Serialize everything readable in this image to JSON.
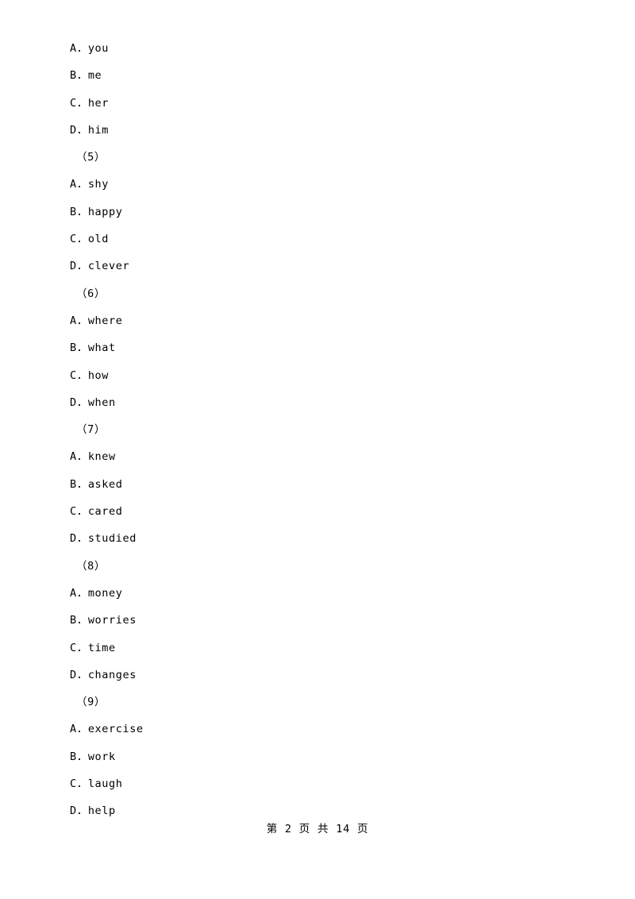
{
  "document": {
    "lines": [
      {
        "type": "option",
        "text": "A．you"
      },
      {
        "type": "option",
        "text": "B．me"
      },
      {
        "type": "option",
        "text": "C．her"
      },
      {
        "type": "option",
        "text": "D．him"
      },
      {
        "type": "group",
        "text": "（5）"
      },
      {
        "type": "option",
        "text": "A．shy"
      },
      {
        "type": "option",
        "text": "B．happy"
      },
      {
        "type": "option",
        "text": "C．old"
      },
      {
        "type": "option",
        "text": "D．clever"
      },
      {
        "type": "group",
        "text": "（6）"
      },
      {
        "type": "option",
        "text": "A．where"
      },
      {
        "type": "option",
        "text": "B．what"
      },
      {
        "type": "option",
        "text": "C．how"
      },
      {
        "type": "option",
        "text": "D．when"
      },
      {
        "type": "group",
        "text": "（7）"
      },
      {
        "type": "option",
        "text": "A．knew"
      },
      {
        "type": "option",
        "text": "B．asked"
      },
      {
        "type": "option",
        "text": "C．cared"
      },
      {
        "type": "option",
        "text": "D．studied"
      },
      {
        "type": "group",
        "text": "（8）"
      },
      {
        "type": "option",
        "text": "A．money"
      },
      {
        "type": "option",
        "text": "B．worries"
      },
      {
        "type": "option",
        "text": "C．time"
      },
      {
        "type": "option",
        "text": "D．changes"
      },
      {
        "type": "group",
        "text": "（9）"
      },
      {
        "type": "option",
        "text": "A．exercise"
      },
      {
        "type": "option",
        "text": "B．work"
      },
      {
        "type": "option",
        "text": "C．laugh"
      },
      {
        "type": "option",
        "text": "D．help"
      }
    ],
    "footer": "第 2 页 共 14 页"
  }
}
